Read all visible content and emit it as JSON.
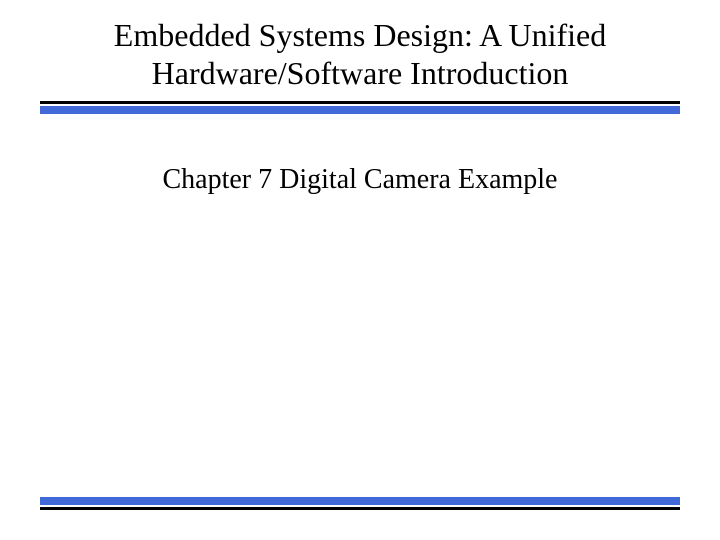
{
  "slide": {
    "title": "Embedded Systems Design: A Unified Hardware/Software Introduction",
    "subtitle": "Chapter 7 Digital Camera Example"
  },
  "colors": {
    "accent": "#4169d8"
  }
}
